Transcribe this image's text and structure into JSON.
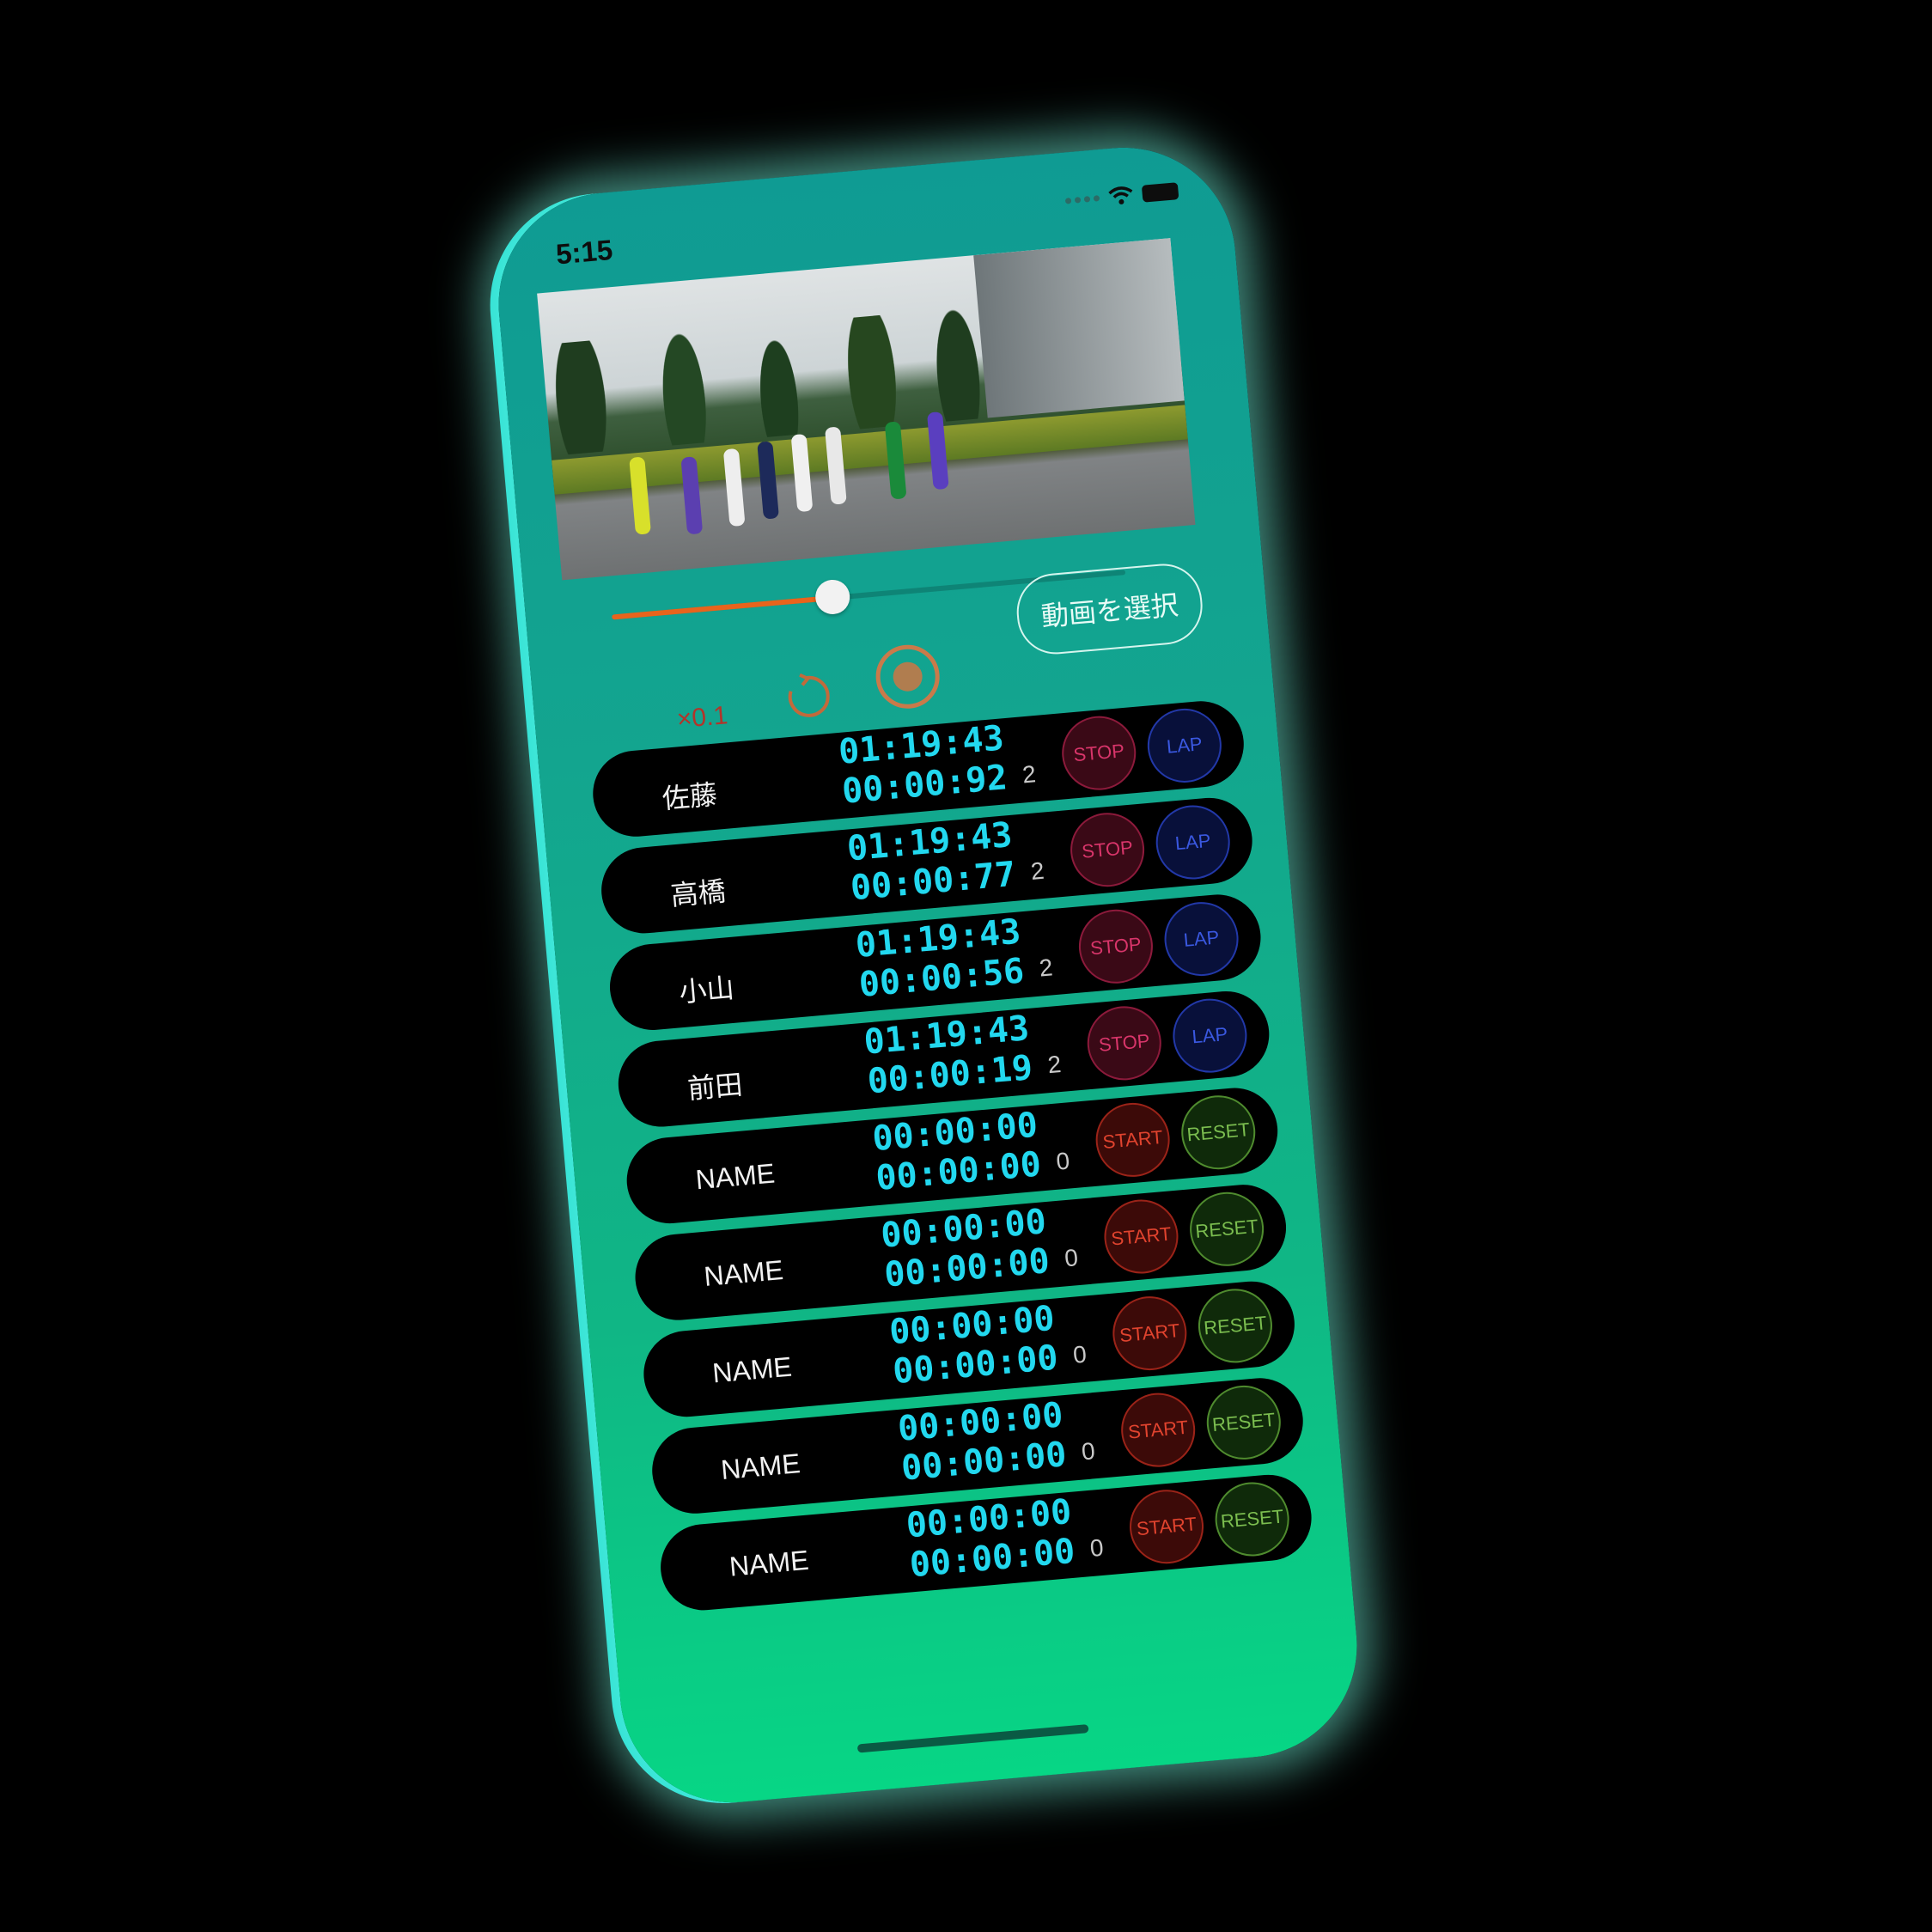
{
  "status_bar": {
    "time": "5:15"
  },
  "video": {
    "progress": 0.43
  },
  "controls": {
    "select_video_label": "動画を選択",
    "speed_label": "×0.1"
  },
  "rows": [
    {
      "name": "佐藤",
      "total": "01:19:43",
      "lap": "00:00:92",
      "count": "2",
      "left_label": "STOP",
      "right_label": "LAP",
      "left_type": "stop",
      "right_type": "lap"
    },
    {
      "name": "高橋",
      "total": "01:19:43",
      "lap": "00:00:77",
      "count": "2",
      "left_label": "STOP",
      "right_label": "LAP",
      "left_type": "stop",
      "right_type": "lap"
    },
    {
      "name": "小山",
      "total": "01:19:43",
      "lap": "00:00:56",
      "count": "2",
      "left_label": "STOP",
      "right_label": "LAP",
      "left_type": "stop",
      "right_type": "lap"
    },
    {
      "name": "前田",
      "total": "01:19:43",
      "lap": "00:00:19",
      "count": "2",
      "left_label": "STOP",
      "right_label": "LAP",
      "left_type": "stop",
      "right_type": "lap"
    },
    {
      "name": "NAME",
      "total": "00:00:00",
      "lap": "00:00:00",
      "count": "0",
      "left_label": "START",
      "right_label": "RESET",
      "left_type": "start",
      "right_type": "reset"
    },
    {
      "name": "NAME",
      "total": "00:00:00",
      "lap": "00:00:00",
      "count": "0",
      "left_label": "START",
      "right_label": "RESET",
      "left_type": "start",
      "right_type": "reset"
    },
    {
      "name": "NAME",
      "total": "00:00:00",
      "lap": "00:00:00",
      "count": "0",
      "left_label": "START",
      "right_label": "RESET",
      "left_type": "start",
      "right_type": "reset"
    },
    {
      "name": "NAME",
      "total": "00:00:00",
      "lap": "00:00:00",
      "count": "0",
      "left_label": "START",
      "right_label": "RESET",
      "left_type": "start",
      "right_type": "reset"
    },
    {
      "name": "NAME",
      "total": "00:00:00",
      "lap": "00:00:00",
      "count": "0",
      "left_label": "START",
      "right_label": "RESET",
      "left_type": "start",
      "right_type": "reset"
    }
  ],
  "colors": {
    "background": "#000000",
    "screen_top": "#0f9b93",
    "screen_bottom": "#07d685",
    "timer_text": "#22d8ef",
    "slider_fill": "#e8641c"
  },
  "icons": [
    "wifi-icon",
    "battery-icon",
    "replay-icon",
    "record-icon"
  ]
}
